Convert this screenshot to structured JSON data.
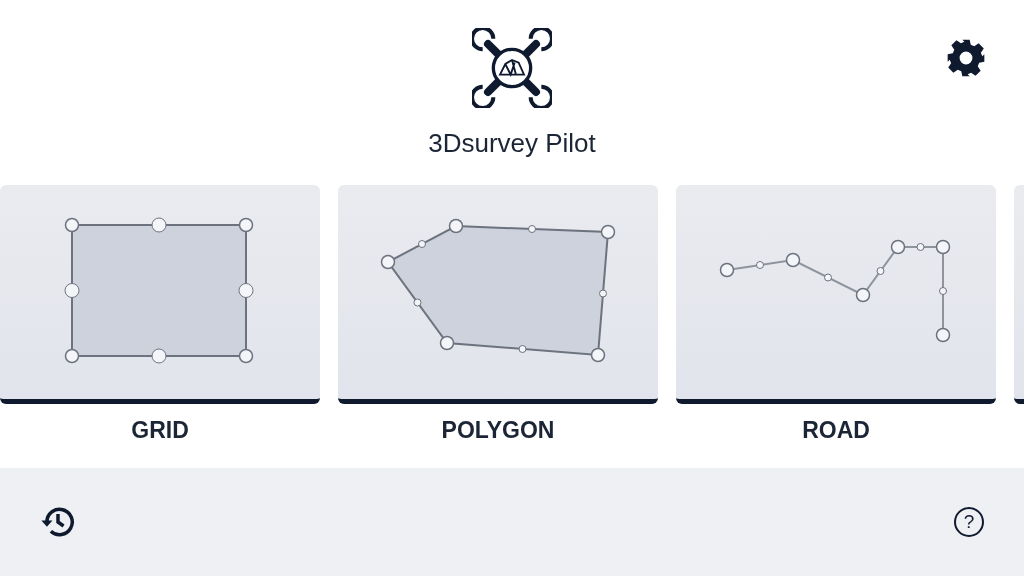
{
  "app": {
    "title": "3Dsurvey Pilot"
  },
  "modes": [
    {
      "kind": "grid",
      "label": "GRID"
    },
    {
      "kind": "polygon",
      "label": "POLYGON"
    },
    {
      "kind": "road",
      "label": "ROAD"
    },
    {
      "kind": "cut_off"
    }
  ],
  "bottom_bar": {
    "help_label": "?"
  }
}
